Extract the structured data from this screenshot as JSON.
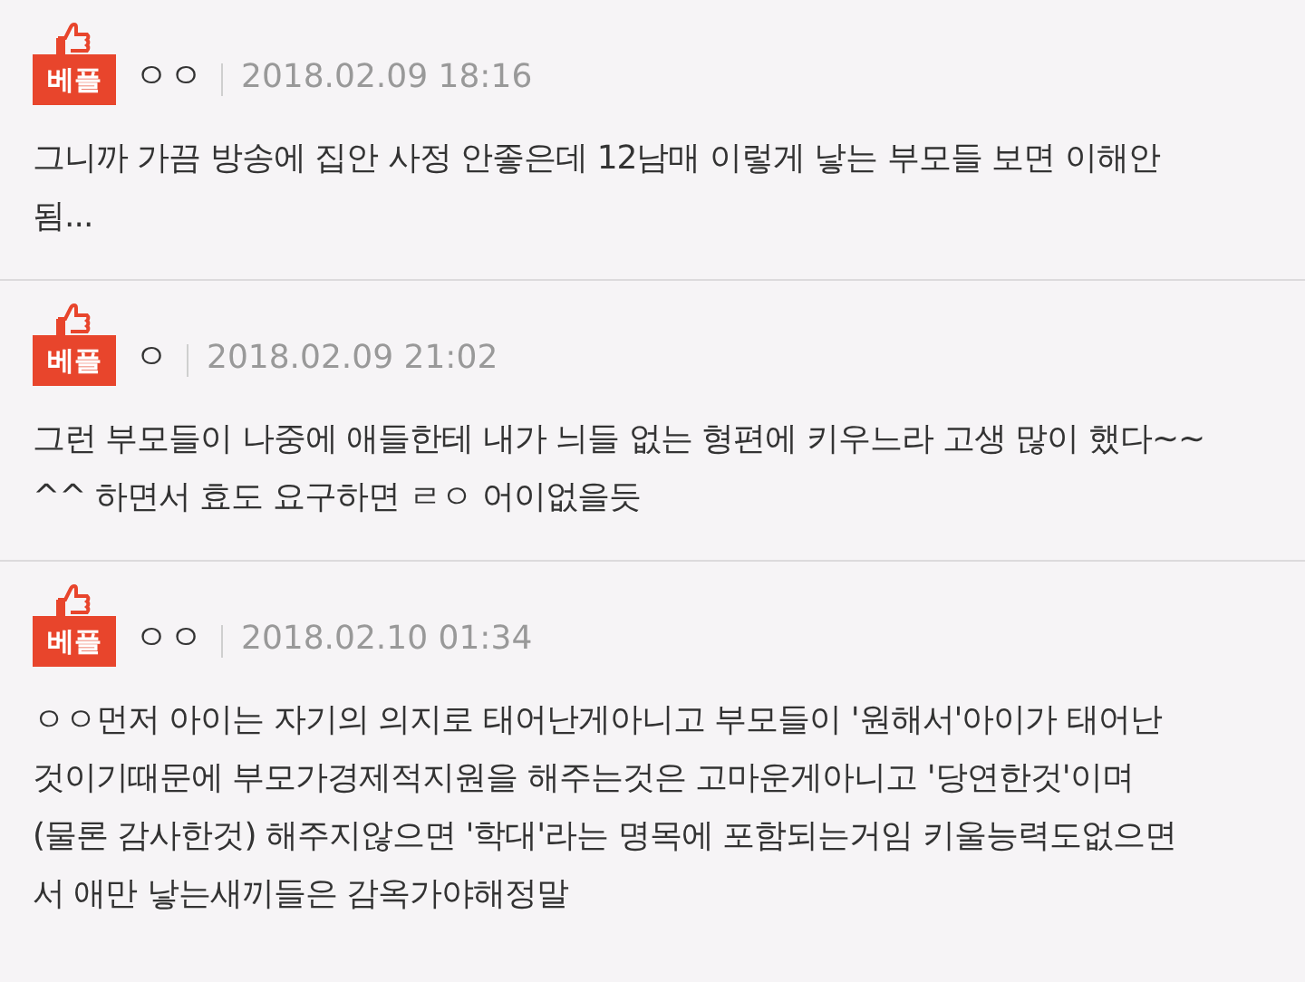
{
  "comments": [
    {
      "badge": "베플",
      "author": "ㅇㅇ",
      "date": "2018.02.09 18:16",
      "lines": [
        "그니까 가끔 방송에 집안 사정 안좋은데 12남매 이렇게 낳는 부모들 보면 이해안",
        "됨..."
      ]
    },
    {
      "badge": "베플",
      "author": "ㅇ",
      "date": "2018.02.09 21:02",
      "lines": [
        "그런 부모들이 나중에 애들한테 내가 늬들 없는 형편에 키우느라 고생 많이 했다~~",
        "^^ 하면서 효도 요구하면 ㄹㅇ 어이없을듯"
      ]
    },
    {
      "badge": "베플",
      "author": "ㅇㅇ",
      "date": "2018.02.10 01:34",
      "lines": [
        "ㅇㅇ먼저 아이는 자기의 의지로 태어난게아니고 부모들이 '원해서'아이가 태어난",
        "것이기때문에 부모가경제적지원을 해주는것은 고마운게아니고 '당연한것'이며",
        "(물론 감사한것) 해주지않으면 '학대'라는 명목에 포함되는거임 키울능력도없으면",
        "서 애만 낳는새끼들은 감옥가야해정말"
      ]
    }
  ]
}
